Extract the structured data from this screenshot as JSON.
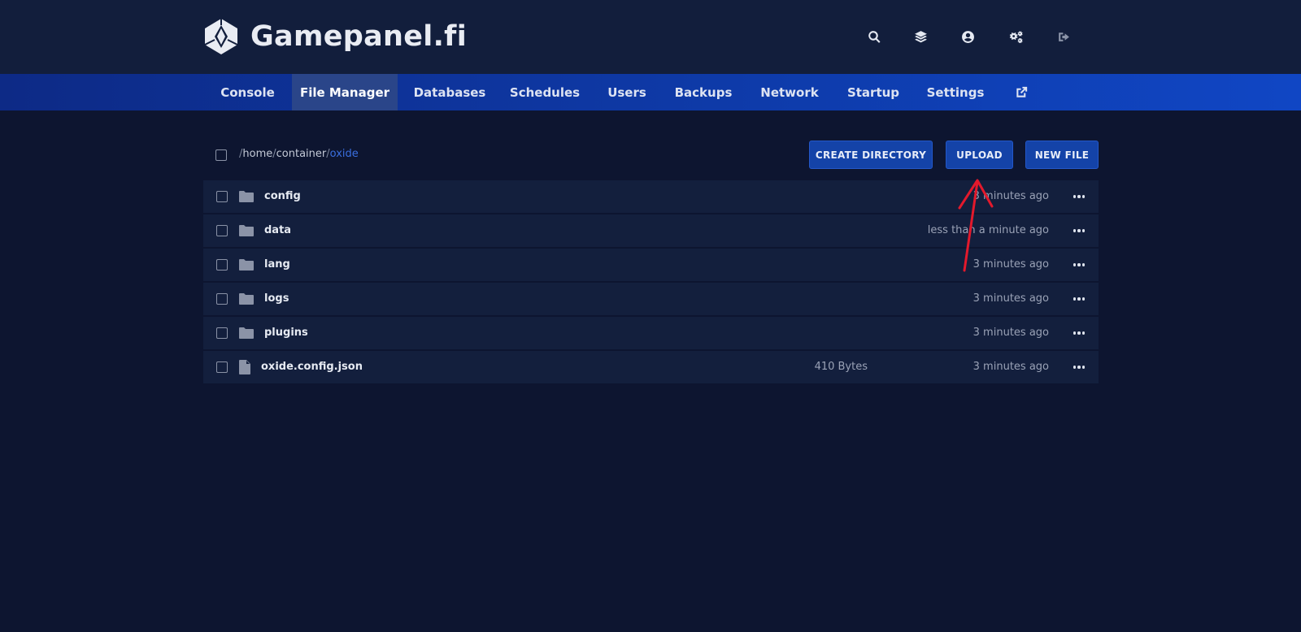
{
  "header": {
    "brand": "Gamepanel.fi",
    "icons": [
      "search-icon",
      "layers-icon",
      "account-icon",
      "cogs-icon",
      "logout-icon"
    ]
  },
  "nav": {
    "items": [
      {
        "label": "Console"
      },
      {
        "label": "File Manager",
        "active": true
      },
      {
        "label": "Databases"
      },
      {
        "label": "Schedules"
      },
      {
        "label": "Users"
      },
      {
        "label": "Backups"
      },
      {
        "label": "Network"
      },
      {
        "label": "Startup"
      },
      {
        "label": "Settings"
      }
    ],
    "external_icon": "external-link-icon"
  },
  "path": {
    "sep": "/",
    "segments": [
      "home",
      "container"
    ],
    "current": "oxide"
  },
  "actions": {
    "create_directory": "CREATE DIRECTORY",
    "upload": "UPLOAD",
    "new_file": "NEW FILE"
  },
  "files": [
    {
      "name": "config",
      "type": "folder",
      "size": "",
      "modified": "3 minutes ago"
    },
    {
      "name": "data",
      "type": "folder",
      "size": "",
      "modified": "less than a minute ago"
    },
    {
      "name": "lang",
      "type": "folder",
      "size": "",
      "modified": "3 minutes ago"
    },
    {
      "name": "logs",
      "type": "folder",
      "size": "",
      "modified": "3 minutes ago"
    },
    {
      "name": "plugins",
      "type": "folder",
      "size": "",
      "modified": "3 minutes ago"
    },
    {
      "name": "oxide.config.json",
      "type": "file",
      "size": "410 Bytes",
      "modified": "3 minutes ago"
    }
  ],
  "colors": {
    "background": "#0d1530",
    "header": "#121e3c",
    "nav_accent": "#0e3aa8",
    "button": "#1443a8",
    "path_current": "#3a6fe0",
    "annotation": "#e3192c"
  }
}
